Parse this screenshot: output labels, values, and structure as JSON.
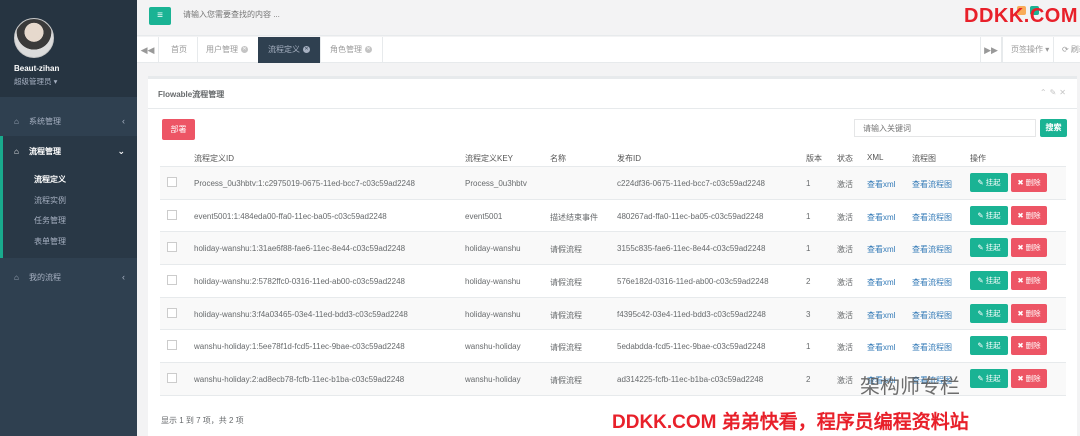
{
  "profile": {
    "name": "Beaut-zihan",
    "role": "超级管理员 ▾"
  },
  "sidebar": {
    "items": [
      {
        "label": "系统管理"
      },
      {
        "label": "流程管理"
      },
      {
        "label": "我的流程"
      }
    ],
    "sub": [
      "流程定义",
      "流程实例",
      "任务管理",
      "表单管理"
    ]
  },
  "topbar": {
    "search_placeholder": "请输入您需要查找的内容 ...",
    "brand": "DDKK.COM"
  },
  "tabs": {
    "home": "首页",
    "items": [
      "用户管理",
      "流程定义",
      "角色管理"
    ],
    "page_ops": "页签操作 ▾",
    "refresh": "⟳ 刷新"
  },
  "panel": {
    "title": "Flowable流程管理",
    "deploy": "部署",
    "keyword_placeholder": "请输入关键词",
    "search": "搜索",
    "footer": "显示 1 到 7 项，共 2 项"
  },
  "table": {
    "headers": {
      "id": "流程定义ID",
      "key": "流程定义KEY",
      "name": "名称",
      "deploy_id": "发布ID",
      "version": "版本",
      "status": "状态",
      "xml": "XML",
      "diagram": "流程图",
      "ops": "操作"
    },
    "rows": [
      {
        "id": "Process_0u3hbtv:1:c2975019-0675-11ed-bcc7-c03c59ad2248",
        "key": "Process_0u3hbtv",
        "name": "",
        "deploy_id": "c224df36-0675-11ed-bcc7-c03c59ad2248",
        "version": "1",
        "status": "激活",
        "xml": "查看xml",
        "diagram": "查看流程图",
        "suspend": "✎ 挂起",
        "delete": "✖ 删除"
      },
      {
        "id": "event5001:1:484eda00-ffa0-11ec-ba05-c03c59ad2248",
        "key": "event5001",
        "name": "描述结束事件",
        "deploy_id": "480267ad-ffa0-11ec-ba05-c03c59ad2248",
        "version": "1",
        "status": "激活",
        "xml": "查看xml",
        "diagram": "查看流程图",
        "suspend": "✎ 挂起",
        "delete": "✖ 删除"
      },
      {
        "id": "holiday-wanshu:1:31ae6f88-fae6-11ec-8e44-c03c59ad2248",
        "key": "holiday-wanshu",
        "name": "请假流程",
        "deploy_id": "3155c835-fae6-11ec-8e44-c03c59ad2248",
        "version": "1",
        "status": "激活",
        "xml": "查看xml",
        "diagram": "查看流程图",
        "suspend": "✎ 挂起",
        "delete": "✖ 删除"
      },
      {
        "id": "holiday-wanshu:2:5782ffc0-0316-11ed-ab00-c03c59ad2248",
        "key": "holiday-wanshu",
        "name": "请假流程",
        "deploy_id": "576e182d-0316-11ed-ab00-c03c59ad2248",
        "version": "2",
        "status": "激活",
        "xml": "查看xml",
        "diagram": "查看流程图",
        "suspend": "✎ 挂起",
        "delete": "✖ 删除"
      },
      {
        "id": "holiday-wanshu:3:f4a03465-03e4-11ed-bdd3-c03c59ad2248",
        "key": "holiday-wanshu",
        "name": "请假流程",
        "deploy_id": "f4395c42-03e4-11ed-bdd3-c03c59ad2248",
        "version": "3",
        "status": "激活",
        "xml": "查看xml",
        "diagram": "查看流程图",
        "suspend": "✎ 挂起",
        "delete": "✖ 删除"
      },
      {
        "id": "wanshu-holiday:1:5ee78f1d-fcd5-11ec-9bae-c03c59ad2248",
        "key": "wanshu-holiday",
        "name": "请假流程",
        "deploy_id": "5edabdda-fcd5-11ec-9bae-c03c59ad2248",
        "version": "1",
        "status": "激活",
        "xml": "查看xml",
        "diagram": "查看流程图",
        "suspend": "✎ 挂起",
        "delete": "✖ 删除"
      },
      {
        "id": "wanshu-holiday:2:ad8ecb78-fcfb-11ec-b1ba-c03c59ad2248",
        "key": "wanshu-holiday",
        "name": "请假流程",
        "deploy_id": "ad314225-fcfb-11ec-b1ba-c03c59ad2248",
        "version": "2",
        "status": "激活",
        "xml": "查看xml",
        "diagram": "查看流程图",
        "suspend": "✎ 挂起",
        "delete": "✖ 删除"
      }
    ]
  },
  "overlay": {
    "banner": "DDKK.COM 弟弟快看，程序员编程资料站",
    "watermark": "架构师专栏"
  },
  "colors": {
    "sidebar": "#2f4050",
    "accent": "#1ab394",
    "danger": "#ed5565",
    "link": "#337ab7",
    "brand_red": "#e8202a"
  }
}
